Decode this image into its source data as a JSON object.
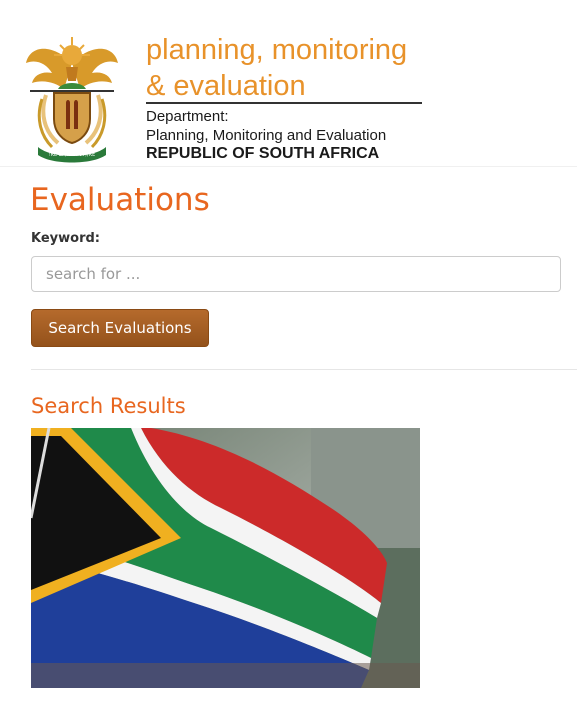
{
  "header": {
    "brand_line1": "planning, monitoring",
    "brand_line2": "& evaluation",
    "dept_line1": "Department:",
    "dept_line2": "Planning, Monitoring and Evaluation",
    "dept_line3": "REPUBLIC OF SOUTH AFRICA",
    "crest_icon": "coat-of-arms-icon"
  },
  "main": {
    "title": "Evaluations",
    "keyword_label": "Keyword:",
    "search": {
      "placeholder": "search for ...",
      "value": ""
    },
    "search_button_label": "Search Evaluations",
    "results_heading": "Search Results",
    "result_image_icon": "south-african-flag-image"
  },
  "colors": {
    "accent_orange": "#e8661f",
    "brand_orange": "#e8922a",
    "button_brown": "#a45e24"
  }
}
